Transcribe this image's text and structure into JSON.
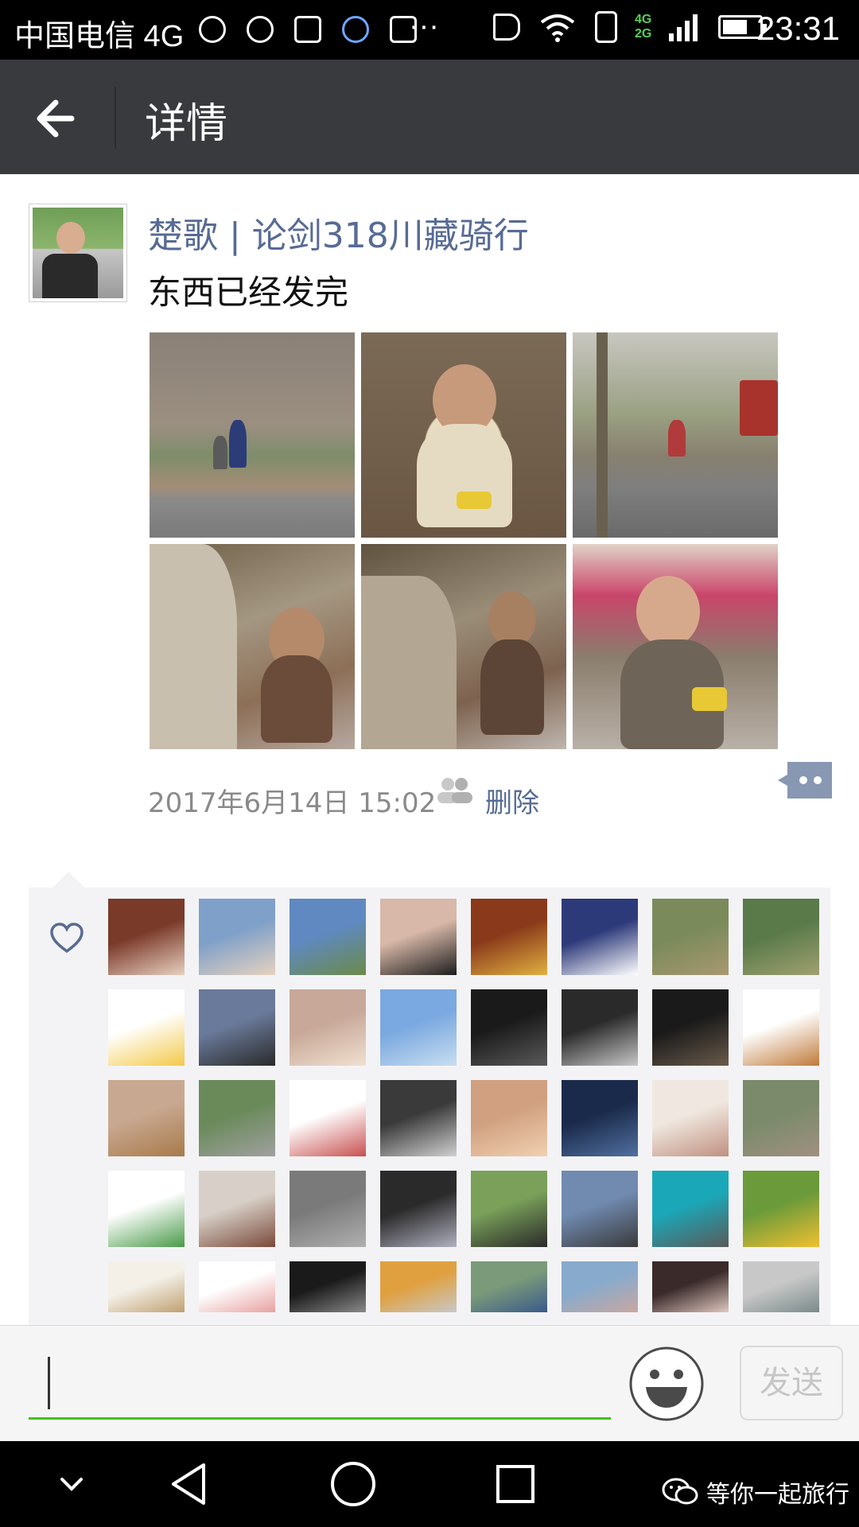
{
  "status_bar": {
    "carrier": "中国电信 4G",
    "network_top": "4G",
    "network_bottom": "2G",
    "time": "23:31",
    "icons": [
      "missed-call-icon",
      "chat-bubble-icon",
      "tools-icon",
      "notification-icon",
      "image-icon",
      "more-icon",
      "mute-icon",
      "wifi-icon",
      "sim-icon",
      "signal-icon",
      "battery-icon"
    ]
  },
  "header": {
    "title": "详情"
  },
  "post": {
    "username": "楚歌 | 论剑318川藏骑行",
    "text": "东西已经发完",
    "timestamp": "2017年6月14日 15:02",
    "delete_label": "删除",
    "photo_count": 6
  },
  "likes": {
    "avatar_count": 40
  },
  "composer": {
    "input_value": "",
    "send_label": "发送"
  },
  "watermark": {
    "text": "等你一起旅行"
  },
  "colors": {
    "link": "#576b95",
    "titlebar": "#393a3e",
    "input_underline": "#45c01a",
    "likes_bg": "#f3f3f5"
  }
}
